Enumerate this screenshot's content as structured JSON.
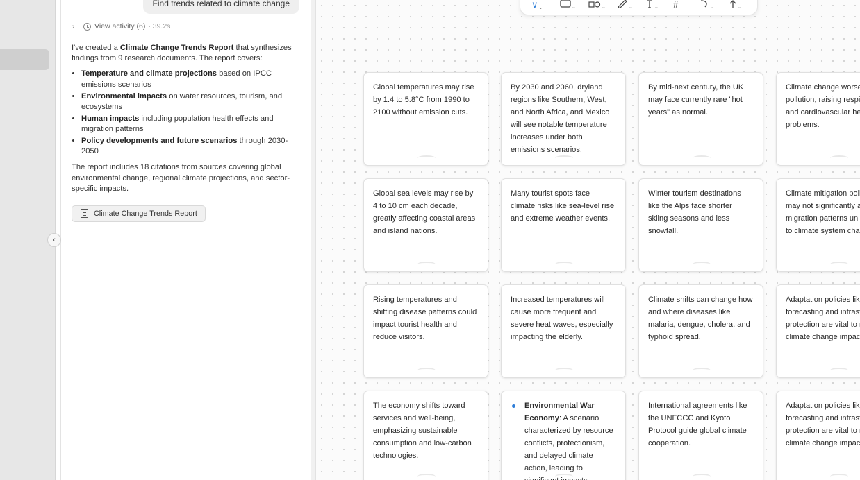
{
  "chat": {
    "user_message": "Find trends related to climate change",
    "activity_label": "View activity (6)",
    "activity_time": "· 39.2s",
    "intro_1": "I've created a ",
    "intro_bold": "Climate Change Trends Report",
    "intro_2": " that synthesizes findings from 9 research documents. The report covers:",
    "bullets": [
      {
        "bold": "Temperature and climate projections",
        "rest": " based on IPCC emissions scenarios"
      },
      {
        "bold": "Environmental impacts",
        "rest": " on water resources, tourism, and ecosystems"
      },
      {
        "bold": "Human impacts",
        "rest": " including population health effects and migration patterns"
      },
      {
        "bold": "Policy developments and future scenarios",
        "rest": " through 2030-2050"
      }
    ],
    "summary": "The report includes 18 citations from sources covering global environmental change, regional climate projections, and sector-specific impacts.",
    "report_chip": "Climate Change Trends Report"
  },
  "icons": {
    "collapse": "chevron-left-icon",
    "activity_toggle": "chevron-right-icon",
    "clock": "clock-icon",
    "report": "document-icon"
  },
  "toolbar": {
    "tools": [
      "select-tool",
      "shape-tool",
      "components-tool",
      "pen-tool",
      "text-tool",
      "frame-tool",
      "connector-tool",
      "upload-tool"
    ]
  },
  "canvas": {
    "cards": [
      {
        "text": "Global temperatures may rise by 1.4 to 5.8°C from 1990 to 2100 without emission cuts."
      },
      {
        "text": "By 2030 and 2060, dryland regions like Southern, West, and North Africa, and Mexico will see notable temperature increases under both emissions scenarios."
      },
      {
        "text": "By mid-next century, the UK may face currently rare \"hot years\" as normal."
      },
      {
        "text": "Climate change worsens pollution, raising respiratory and cardiovascular health problems."
      },
      {
        "text": "Global sea levels may rise by 4 to 10 cm each decade, greatly affecting coastal areas and island nations."
      },
      {
        "text": "Many tourist spots face climate risks like sea-level rise and extreme weather events."
      },
      {
        "text": "Winter tourism destinations like the Alps face shorter skiing seasons and less snowfall."
      },
      {
        "text": "Climate mitigation policies may not significantly alter migration patterns unless due to climate system changes."
      },
      {
        "text": "Rising temperatures and shifting disease patterns could impact tourist health and reduce visitors."
      },
      {
        "text": "Increased temperatures will cause more frequent and severe heat waves, especially impacting the elderly."
      },
      {
        "text": "Climate shifts can change how and where diseases like malaria, dengue, cholera, and typhoid spread."
      },
      {
        "text": "Adaptation policies like forecasting and infrastructure protection are vital to manage climate change impacts."
      },
      {
        "text": "The economy shifts toward services and well-being, emphasizing sustainable consumption and low-carbon technologies."
      },
      {
        "bold": "Environmental War Economy",
        "text": ": A scenario characterized by resource conflicts, protectionism, and delayed climate action, leading to significant impacts."
      },
      {
        "text": "International agreements like the UNFCCC and Kyoto Protocol guide global climate cooperation."
      },
      {
        "text": "Adaptation policies like forecasting and infrastructure protection are vital to manage climate change impacts."
      }
    ]
  }
}
